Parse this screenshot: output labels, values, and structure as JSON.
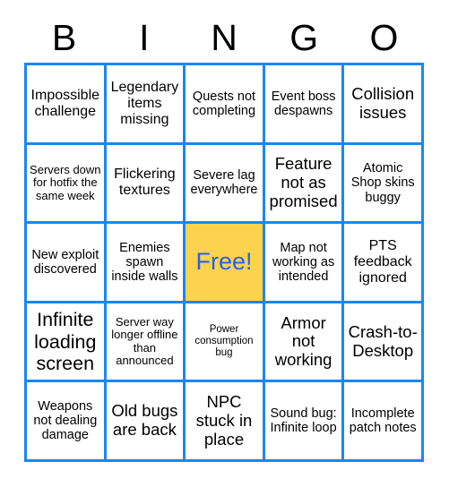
{
  "card": {
    "title": "BINGO",
    "header_letters": [
      "B",
      "I",
      "N",
      "G",
      "O"
    ],
    "colors": {
      "border": "#1a87f0",
      "free_background": "#fcd34d",
      "free_text": "#2563eb",
      "cell_background": "#ffffff",
      "cell_text": "#000000",
      "page_background": "#ffffff"
    },
    "grid_size": "5x5",
    "rows": [
      [
        {
          "text": "Impossible challenge",
          "size": "l",
          "free": false
        },
        {
          "text": "Legendary items missing",
          "size": "l",
          "free": false
        },
        {
          "text": "Quests not completing",
          "size": "m",
          "free": false
        },
        {
          "text": "Event boss despawns",
          "size": "m",
          "free": false
        },
        {
          "text": "Collision issues",
          "size": "xl",
          "free": false
        }
      ],
      [
        {
          "text": "Servers down for hotfix the same week",
          "size": "s",
          "free": false
        },
        {
          "text": "Flickering textures",
          "size": "l",
          "free": false
        },
        {
          "text": "Severe lag everywhere",
          "size": "m",
          "free": false
        },
        {
          "text": "Feature not as promised",
          "size": "xl",
          "free": false
        },
        {
          "text": "Atomic Shop skins buggy",
          "size": "m",
          "free": false
        }
      ],
      [
        {
          "text": "New exploit discovered",
          "size": "m",
          "free": false
        },
        {
          "text": "Enemies spawn inside walls",
          "size": "m",
          "free": false
        },
        {
          "text": "Free!",
          "size": "free",
          "free": true
        },
        {
          "text": "Map not working as intended",
          "size": "m",
          "free": false
        },
        {
          "text": "PTS feedback ignored",
          "size": "l",
          "free": false
        }
      ],
      [
        {
          "text": "Infinite loading screen",
          "size": "xxl",
          "free": false
        },
        {
          "text": "Server way longer offline than announced",
          "size": "s",
          "free": false
        },
        {
          "text": "Power consumption bug",
          "size": "xs",
          "free": false
        },
        {
          "text": "Armor not working",
          "size": "xl",
          "free": false
        },
        {
          "text": "Crash-to-Desktop",
          "size": "xl",
          "free": false
        }
      ],
      [
        {
          "text": "Weapons not dealing damage",
          "size": "m",
          "free": false
        },
        {
          "text": "Old bugs are back",
          "size": "xl",
          "free": false
        },
        {
          "text": "NPC stuck in place",
          "size": "xl",
          "free": false
        },
        {
          "text": "Sound bug: Infinite loop",
          "size": "m",
          "free": false
        },
        {
          "text": "Incomplete patch notes",
          "size": "m",
          "free": false
        }
      ]
    ]
  }
}
